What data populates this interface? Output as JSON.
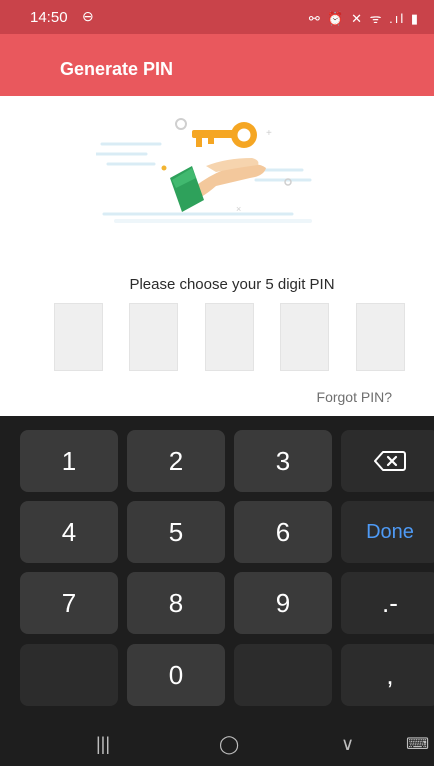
{
  "status_bar": {
    "time": "14:50",
    "icons": "⊖",
    "right_icons": "⚯ ⏰ ✕ ᯤ .ıl ▮"
  },
  "app_bar": {
    "title": "Generate PIN"
  },
  "main": {
    "instruction": "Please choose your 5 digit PIN",
    "pin_length": 5,
    "forgot_label": "Forgot PIN?"
  },
  "keyboard": {
    "keys": {
      "k1": "1",
      "k2": "2",
      "k3": "3",
      "backspace": "⌫",
      "k4": "4",
      "k5": "5",
      "k6": "6",
      "done": "Done",
      "k7": "7",
      "k8": "8",
      "k9": "9",
      "dotdash": ".-",
      "k0": "0",
      "comma": ","
    }
  },
  "nav_bar": {
    "recents": "|||",
    "home": "◯",
    "back": "∨",
    "keyboard_toggle": "⌨"
  },
  "colors": {
    "accent": "#e9585d",
    "status_bg": "#c9434a",
    "done_blue": "#4e9af5"
  },
  "icons": {
    "illustration": "hand-holding-key-illustration"
  }
}
